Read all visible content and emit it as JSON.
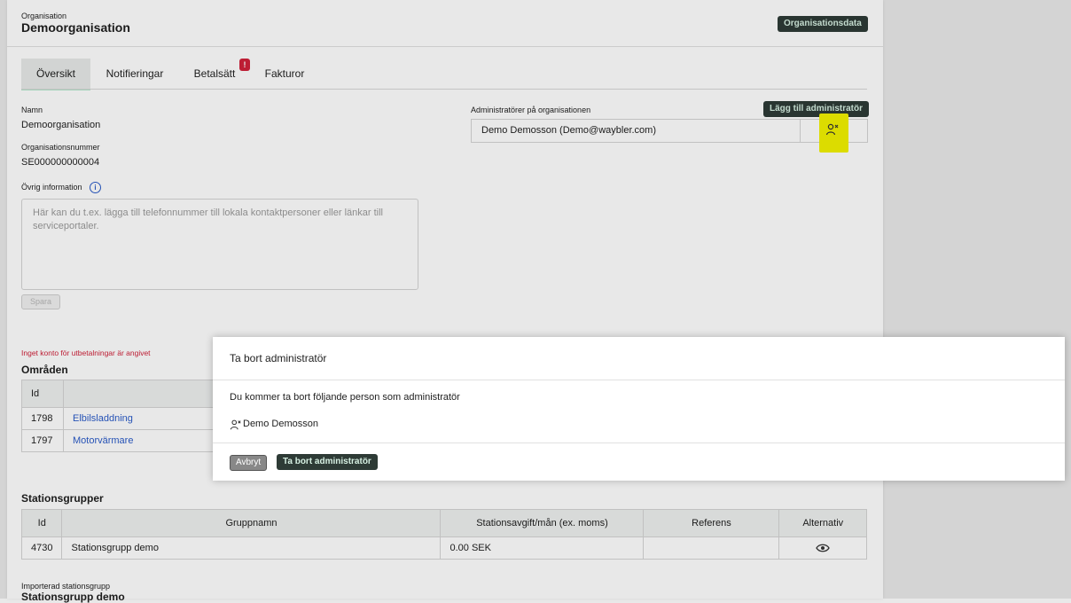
{
  "header": {
    "org_label": "Organisation",
    "org_name": "Demoorganisation",
    "org_data_button": "Organisationsdata"
  },
  "tabs": [
    {
      "label": "Översikt"
    },
    {
      "label": "Notifieringar"
    },
    {
      "label": "Betalsätt",
      "badge": "!"
    },
    {
      "label": "Fakturor"
    }
  ],
  "overview": {
    "name_label": "Namn",
    "name_value": "Demoorganisation",
    "orgnum_label": "Organisationsnummer",
    "orgnum_value": "SE000000000004",
    "other_info_label": "Övrig information",
    "other_info_placeholder": "Här kan du t.ex. lägga till telefonnummer till lokala kontaktpersoner eller länkar till serviceportaler.",
    "save_button": "Spara"
  },
  "admins": {
    "label": "Administratörer på organisationen",
    "add_button": "Lägg till administratör",
    "rows": [
      {
        "name": "Demo Demosson (Demo@waybler.com)"
      }
    ]
  },
  "warning": "Inget konto för utbetalningar är angivet",
  "areas": {
    "title": "Områden",
    "col_id": "Id",
    "rows": [
      {
        "id": "1798",
        "name": "Elbilsladdning"
      },
      {
        "id": "1797",
        "name": "Motorvärmare"
      }
    ]
  },
  "station_groups": {
    "title": "Stationsgrupper",
    "columns": [
      "Id",
      "Gruppnamn",
      "Stationsavgift/mån (ex. moms)",
      "Referens",
      "Alternativ"
    ],
    "rows": [
      {
        "id": "4730",
        "name": "Stationsgrupp demo",
        "fee": "0.00 SEK",
        "ref": ""
      }
    ]
  },
  "imported": {
    "label": "Importerad stationsgrupp",
    "value": "Stationsgrupp demo"
  },
  "modal": {
    "title": "Ta bort administratör",
    "body": "Du kommer ta bort följande person som administratör",
    "person": "Demo Demosson",
    "cancel_button": "Avbryt",
    "confirm_button": "Ta bort administratör"
  },
  "colors": {
    "accent": "#2e3b36",
    "accent_text": "#d6f0e2",
    "link": "#2a5bc8",
    "warning": "#d0213a",
    "highlight": "#f2f200"
  }
}
